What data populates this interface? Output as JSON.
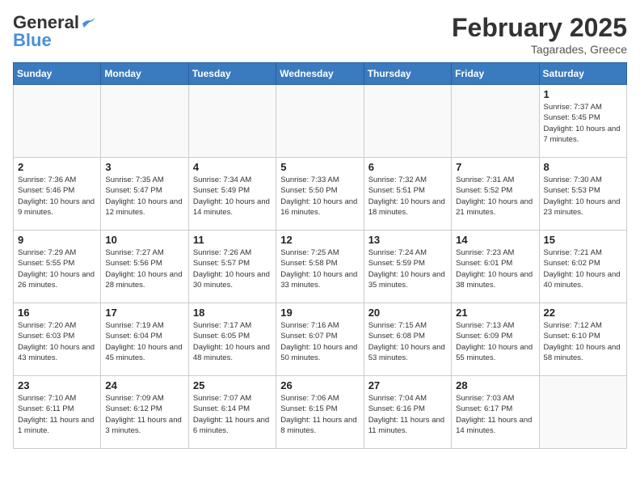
{
  "header": {
    "logo_line1": "General",
    "logo_line2": "Blue",
    "month_title": "February 2025",
    "location": "Tagarades, Greece"
  },
  "weekdays": [
    "Sunday",
    "Monday",
    "Tuesday",
    "Wednesday",
    "Thursday",
    "Friday",
    "Saturday"
  ],
  "weeks": [
    [
      {
        "day": "",
        "info": ""
      },
      {
        "day": "",
        "info": ""
      },
      {
        "day": "",
        "info": ""
      },
      {
        "day": "",
        "info": ""
      },
      {
        "day": "",
        "info": ""
      },
      {
        "day": "",
        "info": ""
      },
      {
        "day": "1",
        "info": "Sunrise: 7:37 AM\nSunset: 5:45 PM\nDaylight: 10 hours and 7 minutes."
      }
    ],
    [
      {
        "day": "2",
        "info": "Sunrise: 7:36 AM\nSunset: 5:46 PM\nDaylight: 10 hours and 9 minutes."
      },
      {
        "day": "3",
        "info": "Sunrise: 7:35 AM\nSunset: 5:47 PM\nDaylight: 10 hours and 12 minutes."
      },
      {
        "day": "4",
        "info": "Sunrise: 7:34 AM\nSunset: 5:49 PM\nDaylight: 10 hours and 14 minutes."
      },
      {
        "day": "5",
        "info": "Sunrise: 7:33 AM\nSunset: 5:50 PM\nDaylight: 10 hours and 16 minutes."
      },
      {
        "day": "6",
        "info": "Sunrise: 7:32 AM\nSunset: 5:51 PM\nDaylight: 10 hours and 18 minutes."
      },
      {
        "day": "7",
        "info": "Sunrise: 7:31 AM\nSunset: 5:52 PM\nDaylight: 10 hours and 21 minutes."
      },
      {
        "day": "8",
        "info": "Sunrise: 7:30 AM\nSunset: 5:53 PM\nDaylight: 10 hours and 23 minutes."
      }
    ],
    [
      {
        "day": "9",
        "info": "Sunrise: 7:29 AM\nSunset: 5:55 PM\nDaylight: 10 hours and 26 minutes."
      },
      {
        "day": "10",
        "info": "Sunrise: 7:27 AM\nSunset: 5:56 PM\nDaylight: 10 hours and 28 minutes."
      },
      {
        "day": "11",
        "info": "Sunrise: 7:26 AM\nSunset: 5:57 PM\nDaylight: 10 hours and 30 minutes."
      },
      {
        "day": "12",
        "info": "Sunrise: 7:25 AM\nSunset: 5:58 PM\nDaylight: 10 hours and 33 minutes."
      },
      {
        "day": "13",
        "info": "Sunrise: 7:24 AM\nSunset: 5:59 PM\nDaylight: 10 hours and 35 minutes."
      },
      {
        "day": "14",
        "info": "Sunrise: 7:23 AM\nSunset: 6:01 PM\nDaylight: 10 hours and 38 minutes."
      },
      {
        "day": "15",
        "info": "Sunrise: 7:21 AM\nSunset: 6:02 PM\nDaylight: 10 hours and 40 minutes."
      }
    ],
    [
      {
        "day": "16",
        "info": "Sunrise: 7:20 AM\nSunset: 6:03 PM\nDaylight: 10 hours and 43 minutes."
      },
      {
        "day": "17",
        "info": "Sunrise: 7:19 AM\nSunset: 6:04 PM\nDaylight: 10 hours and 45 minutes."
      },
      {
        "day": "18",
        "info": "Sunrise: 7:17 AM\nSunset: 6:05 PM\nDaylight: 10 hours and 48 minutes."
      },
      {
        "day": "19",
        "info": "Sunrise: 7:16 AM\nSunset: 6:07 PM\nDaylight: 10 hours and 50 minutes."
      },
      {
        "day": "20",
        "info": "Sunrise: 7:15 AM\nSunset: 6:08 PM\nDaylight: 10 hours and 53 minutes."
      },
      {
        "day": "21",
        "info": "Sunrise: 7:13 AM\nSunset: 6:09 PM\nDaylight: 10 hours and 55 minutes."
      },
      {
        "day": "22",
        "info": "Sunrise: 7:12 AM\nSunset: 6:10 PM\nDaylight: 10 hours and 58 minutes."
      }
    ],
    [
      {
        "day": "23",
        "info": "Sunrise: 7:10 AM\nSunset: 6:11 PM\nDaylight: 11 hours and 1 minute."
      },
      {
        "day": "24",
        "info": "Sunrise: 7:09 AM\nSunset: 6:12 PM\nDaylight: 11 hours and 3 minutes."
      },
      {
        "day": "25",
        "info": "Sunrise: 7:07 AM\nSunset: 6:14 PM\nDaylight: 11 hours and 6 minutes."
      },
      {
        "day": "26",
        "info": "Sunrise: 7:06 AM\nSunset: 6:15 PM\nDaylight: 11 hours and 8 minutes."
      },
      {
        "day": "27",
        "info": "Sunrise: 7:04 AM\nSunset: 6:16 PM\nDaylight: 11 hours and 11 minutes."
      },
      {
        "day": "28",
        "info": "Sunrise: 7:03 AM\nSunset: 6:17 PM\nDaylight: 11 hours and 14 minutes."
      },
      {
        "day": "",
        "info": ""
      }
    ]
  ]
}
